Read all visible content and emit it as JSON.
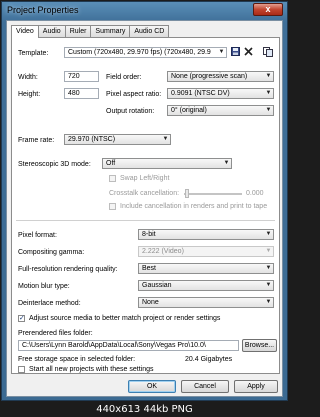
{
  "window": {
    "title": "Project Properties",
    "close_glyph": "x"
  },
  "tabs": [
    {
      "label": "Video",
      "active": true
    },
    {
      "label": "Audio"
    },
    {
      "label": "Ruler"
    },
    {
      "label": "Summary"
    },
    {
      "label": "Audio CD"
    }
  ],
  "video": {
    "template_label": "Template:",
    "template_value": "Custom (720x480, 29.970 fps) (720x480, 29.9",
    "width_label": "Width:",
    "width_value": "720",
    "height_label": "Height:",
    "height_value": "480",
    "field_order_label": "Field order:",
    "field_order_value": "None (progressive scan)",
    "pixel_aspect_label": "Pixel aspect ratio:",
    "pixel_aspect_value": "0.9091 (NTSC DV)",
    "output_rotation_label": "Output rotation:",
    "output_rotation_value": "0° (original)",
    "frame_rate_label": "Frame rate:",
    "frame_rate_value": "29.970 (NTSC)",
    "stereo_label": "Stereoscopic 3D mode:",
    "stereo_value": "Off",
    "swap_label": "Swap Left/Right",
    "crosstalk_label": "Crosstalk cancellation:",
    "crosstalk_value": "0.000",
    "include_cancel_label": "Include cancellation in renders and print to tape",
    "pixel_format_label": "Pixel format:",
    "pixel_format_value": "8-bit",
    "compositing_label": "Compositing gamma:",
    "compositing_value": "2.222 (Video)",
    "full_res_label": "Full-resolution rendering quality:",
    "full_res_value": "Best",
    "motion_blur_label": "Motion blur type:",
    "motion_blur_value": "Gaussian",
    "deinterlace_label": "Deinterlace method:",
    "deinterlace_value": "None",
    "adjust_label": "Adjust source media to better match project or render settings",
    "adjust_checked": true,
    "prerendered_label": "Prerendered files folder:",
    "prerendered_path": "C:\\Users\\Lynn Barold\\AppData\\Local\\Sony\\Vegas Pro\\10.0\\",
    "browse_label": "Browse...",
    "free_space_label": "Free storage space in selected folder:",
    "free_space_value": "20.4 Gigabytes",
    "start_all_label": "Start all new projects with these settings",
    "start_all_checked": false
  },
  "buttons": {
    "ok": "OK",
    "cancel": "Cancel",
    "apply": "Apply"
  },
  "icons": {
    "save": "save-icon",
    "delete": "delete-icon",
    "copy": "copy-icon"
  },
  "caption": "440x613 44kb PNG"
}
